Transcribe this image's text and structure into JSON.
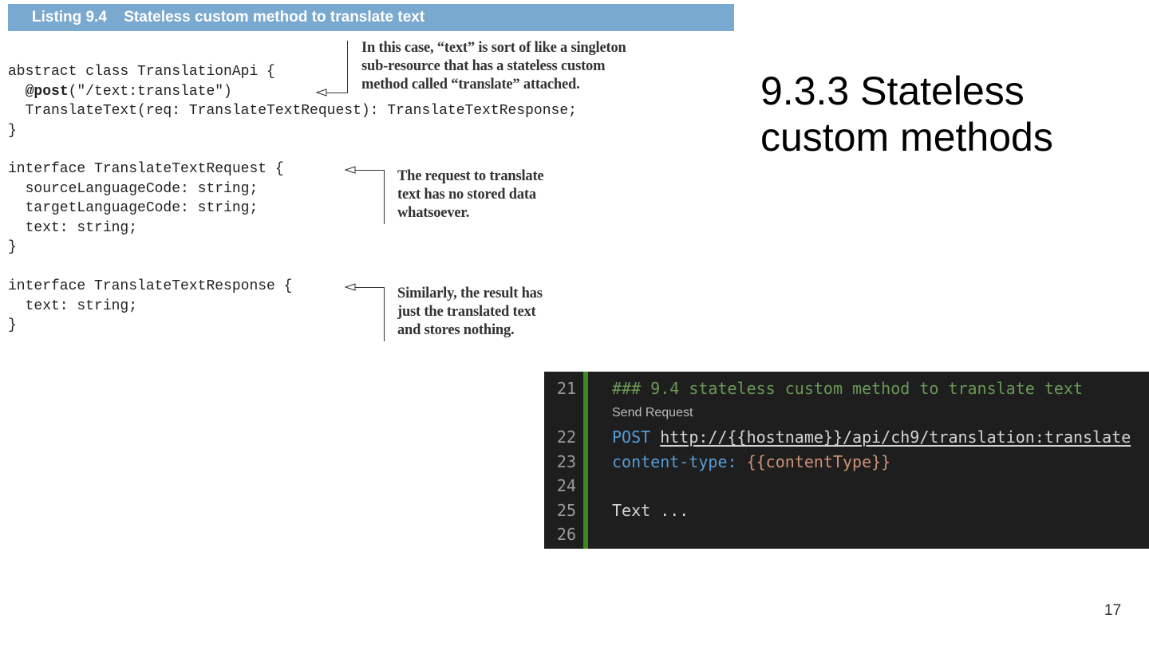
{
  "listing": {
    "label": "Listing 9.4",
    "title": "Stateless custom method to translate text"
  },
  "code": {
    "lines": [
      "abstract class TranslationApi {",
      "@post",
      "(\"/text:translate\")",
      "  TranslateText(req: TranslateTextRequest): TranslateTextResponse;",
      "}",
      "interface TranslateTextRequest {",
      "  sourceLanguageCode: string;",
      "  targetLanguageCode: string;",
      "  text: string;",
      "}",
      "interface TranslateTextResponse {",
      "  text: string;",
      "}"
    ]
  },
  "annotations": {
    "a1": [
      "In this case, “text” is sort of like a singleton",
      "sub-resource that has a stateless custom",
      "method called “translate” attached."
    ],
    "a2": [
      "The request to translate",
      "text has no stored data",
      "whatsoever."
    ],
    "a3": [
      "Similarly, the result has",
      "just the translated text",
      "and stores nothing."
    ]
  },
  "slide": {
    "title_line1": "9.3.3 Stateless",
    "title_line2": "custom methods",
    "page_number": "17"
  },
  "editor": {
    "line_numbers": [
      "21",
      "22",
      "23",
      "24",
      "25",
      "26"
    ],
    "comment": "### 9.4 stateless custom method to translate text",
    "codelens": "Send Request",
    "method": "POST",
    "url": "http://{{hostname}}/api/ch9/translation:translate",
    "header_key": "content-type:",
    "header_value": "{{contentType}}",
    "body": "Text ...",
    "colors": {
      "background": "#1e1e1e",
      "comment": "#6a9955",
      "keyword": "#569cd6",
      "variable": "#ce9178",
      "gutter_bar": "#3c8a1e"
    }
  }
}
